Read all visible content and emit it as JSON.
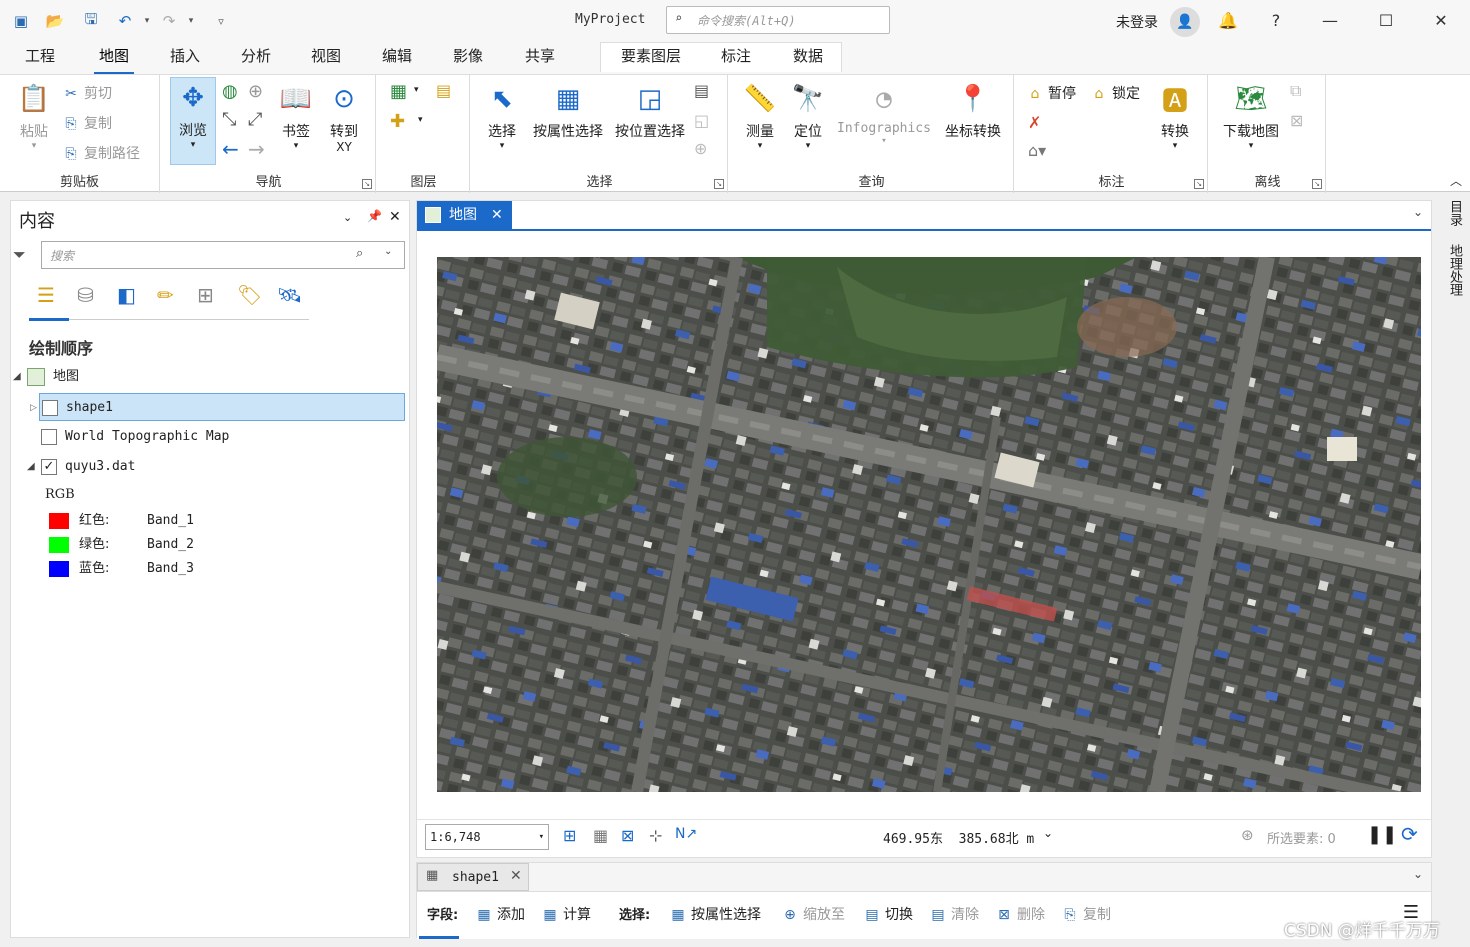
{
  "app": {
    "title": "MyProject",
    "command_search_placeholder": "命令搜索(Alt+Q)",
    "sign_in": "未登录",
    "help": "?"
  },
  "tabs": [
    {
      "label": "工程"
    },
    {
      "label": "地图"
    },
    {
      "label": "插入"
    },
    {
      "label": "分析"
    },
    {
      "label": "视图"
    },
    {
      "label": "编辑"
    },
    {
      "label": "影像"
    },
    {
      "label": "共享"
    },
    {
      "label": "要素图层"
    },
    {
      "label": "标注"
    },
    {
      "label": "数据"
    }
  ],
  "ribbon": {
    "clipboard": {
      "paste": "粘贴",
      "cut": "剪切",
      "copy": "复制",
      "copy_path": "复制路径",
      "label": "剪贴板"
    },
    "navigate": {
      "explore": "浏览",
      "bookmarks": "书签",
      "goto_line1": "转到",
      "goto_line2": "XY",
      "label": "导航"
    },
    "layer": {
      "label": "图层"
    },
    "selection": {
      "select": "选择",
      "select_by_attr": "按属性选择",
      "select_by_loc": "按位置选择",
      "label": "选择"
    },
    "inquiry": {
      "measure": "测量",
      "locate": "定位",
      "infographics": "Infographics",
      "coord_convert": "坐标转换",
      "label": "查询"
    },
    "labeling": {
      "pause": "暂停",
      "lock": "锁定",
      "convert": "转换",
      "label": "标注"
    },
    "offline": {
      "download": "下载地图",
      "label": "离线"
    }
  },
  "contents": {
    "title": "内容",
    "search_placeholder": "搜索",
    "drawing_order": "绘制顺序",
    "map_name": "地图",
    "layers": [
      {
        "name": "shape1",
        "checked": false
      },
      {
        "name": "World Topographic Map",
        "checked": false
      },
      {
        "name": "quyu3.dat",
        "checked": true
      }
    ],
    "rgb_heading": "RGB",
    "bands": [
      {
        "channel": "红色:",
        "band": "Band_1",
        "color": "#ff0000"
      },
      {
        "channel": "绿色:",
        "band": "Band_2",
        "color": "#00ff00"
      },
      {
        "channel": "蓝色:",
        "band": "Band_3",
        "color": "#0000ff"
      }
    ]
  },
  "map_view": {
    "tab_label": "地图",
    "scale": "1:6,748",
    "coordinates": "469.95东  385.68北 m",
    "selected_features": "所选要素: 0"
  },
  "attribute_table": {
    "tab_label": "shape1",
    "field_label": "字段:",
    "add": "添加",
    "calculate": "计算",
    "selection_label": "选择:",
    "select_by_attr": "按属性选择",
    "zoom_to": "缩放至",
    "switch": "切换",
    "clear": "清除",
    "delete": "删除",
    "copy": "复制"
  },
  "right_dock": {
    "catalog": "目录",
    "geoprocessing": "地理处理"
  },
  "watermark": "CSDN @烊千千万万"
}
